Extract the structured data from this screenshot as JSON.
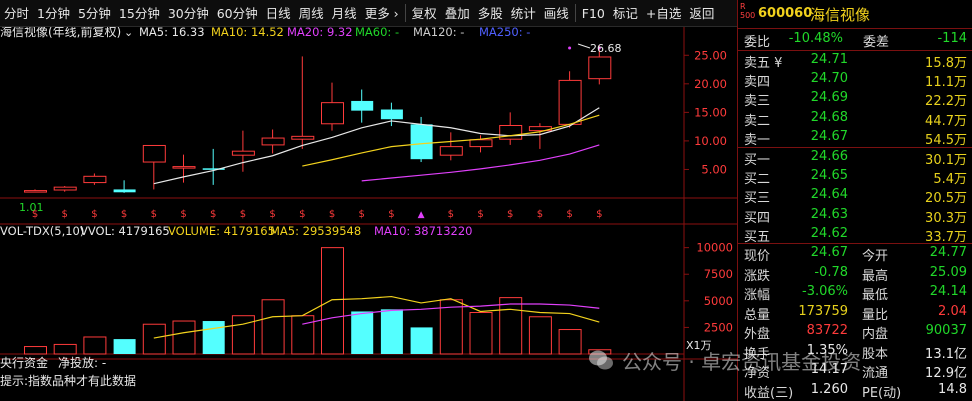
{
  "toolbar": {
    "items": [
      "分时",
      "1分钟",
      "5分钟",
      "15分钟",
      "30分钟",
      "60分钟",
      "日线",
      "周线",
      "月线",
      "更多 ›",
      "复权",
      "叠加",
      "多股",
      "统计",
      "画线",
      "F10",
      "标记",
      "+自选",
      "返回"
    ]
  },
  "kline": {
    "title": "海信视像(年线,前复权)",
    "ma_labels": [
      {
        "text": "MA5: 16.33",
        "color": "#e8e8e8"
      },
      {
        "text": "MA10: 14.52",
        "color": "#f2d21d"
      },
      {
        "text": "MA20: 9.32",
        "color": "#e040fb"
      },
      {
        "text": "MA60: -",
        "color": "#21d82a"
      },
      {
        "text": "MA120: -",
        "color": "#cccccc"
      },
      {
        "text": "MA250: -",
        "color": "#5060ff"
      }
    ],
    "high_label": "26.68",
    "low_label": "1.01",
    "y_ticks": [
      "25.00",
      "20.00",
      "15.00",
      "10.00",
      "5.00"
    ],
    "marker_glyph": "$",
    "marker_arrow": "▲"
  },
  "volume": {
    "title_parts": [
      {
        "text": "VOL-TDX(5,10)",
        "color": "#e8e8e8"
      },
      {
        "text": "VVOL: 4179165",
        "color": "#e8e8e8"
      },
      {
        "text": "VOLUME: 4179165",
        "color": "#f2d21d"
      },
      {
        "text": "MA5: 29539548",
        "color": "#f2d21d"
      },
      {
        "text": "MA10: 38713220",
        "color": "#e040fb"
      }
    ],
    "y_ticks": [
      "10000",
      "7500",
      "5000",
      "2500"
    ],
    "unit_label": "X1万"
  },
  "bottom": {
    "line1_a": "央行资金",
    "line1_b": "净投放: -",
    "line2": "提示:指数品种才有此数据"
  },
  "quote": {
    "code": "600060",
    "name": "海信视像",
    "badge_r": "R",
    "badge_num": "500",
    "weibi_label": "委比",
    "weibi": "-10.48%",
    "weicha_label": "委差",
    "weicha": "-114",
    "asks": [
      {
        "label": "卖五 ¥",
        "price": "24.71",
        "vol": "15.8万"
      },
      {
        "label": "卖四",
        "price": "24.70",
        "vol": "11.1万"
      },
      {
        "label": "卖三",
        "price": "24.69",
        "vol": "22.2万"
      },
      {
        "label": "卖二",
        "price": "24.68",
        "vol": "44.7万"
      },
      {
        "label": "卖一",
        "price": "24.67",
        "vol": "54.5万"
      }
    ],
    "bids": [
      {
        "label": "买一",
        "price": "24.66",
        "vol": "30.1万"
      },
      {
        "label": "买二",
        "price": "24.65",
        "vol": "5.4万"
      },
      {
        "label": "买三",
        "price": "24.64",
        "vol": "20.5万"
      },
      {
        "label": "买四",
        "price": "24.63",
        "vol": "30.3万"
      },
      {
        "label": "买五",
        "price": "24.62",
        "vol": "33.7万"
      }
    ],
    "stats": [
      {
        "l1": "现价",
        "v1": "24.67",
        "c1": "green",
        "l2": "今开",
        "v2": "24.77",
        "c2": "green"
      },
      {
        "l1": "涨跌",
        "v1": "-0.78",
        "c1": "green",
        "l2": "最高",
        "v2": "25.09",
        "c2": "green"
      },
      {
        "l1": "涨幅",
        "v1": "-3.06%",
        "c1": "green",
        "l2": "最低",
        "v2": "24.14",
        "c2": "green"
      },
      {
        "l1": "总量",
        "v1": "173759",
        "c1": "yellow",
        "l2": "量比",
        "v2": "2.04",
        "c2": "red"
      },
      {
        "l1": "外盘",
        "v1": "83722",
        "c1": "red",
        "l2": "内盘",
        "v2": "90037",
        "c2": "green"
      },
      {
        "l1": "换手",
        "v1": "1.35%",
        "c1": "white",
        "l2": "股本",
        "v2": "13.1亿",
        "c2": "white"
      },
      {
        "l1": "净资",
        "v1": "14.17",
        "c1": "white",
        "l2": "流通",
        "v2": "12.9亿",
        "c2": "white"
      },
      {
        "l1": "收益(三)",
        "v1": "1.260",
        "c1": "white",
        "l2": "PE(动)",
        "v2": "14.8",
        "c2": "white"
      }
    ]
  },
  "watermark": "公众号 · 卓宏资讯基金投资",
  "colors": {
    "up": "#ff3b3b",
    "down": "#54ffff",
    "ma5": "#e8e8e8",
    "ma10": "#f2d21d",
    "ma20": "#e040fb",
    "grid": "#8b1010"
  },
  "chart_data": {
    "type": "candlestick",
    "title": "海信视像(年线,前复权)",
    "candles": [
      {
        "open": 1.2,
        "close": 1.3,
        "high": 1.5,
        "low": 1.01
      },
      {
        "open": 1.4,
        "close": 1.9,
        "high": 2.1,
        "low": 1.1
      },
      {
        "open": 2.7,
        "close": 3.8,
        "high": 4.3,
        "low": 2.3
      },
      {
        "open": 1.5,
        "close": 1.0,
        "high": 3.1,
        "low": 0.9
      },
      {
        "open": 6.3,
        "close": 9.2,
        "high": 9.2,
        "low": 1.5
      },
      {
        "open": 5.4,
        "close": 5.5,
        "high": 7.6,
        "low": 2.7
      },
      {
        "open": 5.2,
        "close": 5.0,
        "high": 8.6,
        "low": 2.3
      },
      {
        "open": 7.5,
        "close": 8.2,
        "high": 11.8,
        "low": 4.6
      },
      {
        "open": 9.3,
        "close": 10.5,
        "high": 12.0,
        "low": 7.8
      },
      {
        "open": 10.3,
        "close": 10.8,
        "high": 24.8,
        "low": 8.6
      },
      {
        "open": 13.0,
        "close": 16.7,
        "high": 20.2,
        "low": 11.8
      },
      {
        "open": 17.0,
        "close": 15.3,
        "high": 19.0,
        "low": 13.2
      },
      {
        "open": 15.5,
        "close": 13.8,
        "high": 16.7,
        "low": 12.6
      },
      {
        "open": 12.9,
        "close": 6.8,
        "high": 14.2,
        "low": 6.3
      },
      {
        "open": 7.5,
        "close": 9.0,
        "high": 11.5,
        "low": 6.6
      },
      {
        "open": 9.0,
        "close": 10.2,
        "high": 11.0,
        "low": 8.0
      },
      {
        "open": 10.3,
        "close": 12.7,
        "high": 15.0,
        "low": 9.3
      },
      {
        "open": 11.8,
        "close": 12.5,
        "high": 13.1,
        "low": 8.6
      },
      {
        "open": 12.9,
        "close": 20.6,
        "high": 22.2,
        "low": 12.3
      },
      {
        "open": 20.9,
        "close": 24.7,
        "high": 26.68,
        "low": 19.9
      }
    ],
    "ma5": [
      null,
      null,
      null,
      null,
      2.5,
      3.7,
      4.8,
      6.2,
      7.4,
      9.2,
      10.6,
      12.3,
      13.5,
      12.9,
      12.3,
      11.3,
      10.9,
      11.1,
      12.6,
      15.8
    ],
    "ma10": [
      null,
      null,
      null,
      null,
      null,
      null,
      null,
      null,
      null,
      5.6,
      6.7,
      7.9,
      9.0,
      9.5,
      9.9,
      10.3,
      10.9,
      11.6,
      12.9,
      14.5
    ],
    "ma20": [
      null,
      null,
      null,
      null,
      null,
      null,
      null,
      null,
      null,
      null,
      null,
      3.0,
      3.5,
      4.0,
      4.5,
      5.1,
      5.8,
      6.6,
      7.7,
      9.3
    ],
    "volume": [
      700,
      900,
      1600,
      1400,
      2800,
      3100,
      3100,
      3600,
      5100,
      3600,
      10000,
      4000,
      4200,
      2500,
      5100,
      3900,
      5300,
      3500,
      2300,
      400
    ],
    "vol_ma5": [
      null,
      null,
      null,
      null,
      1500,
      2000,
      2400,
      2800,
      3500,
      3600,
      5100,
      5200,
      5400,
      4800,
      5200,
      4000,
      4200,
      3900,
      3800,
      3000
    ],
    "vol_ma10": [
      null,
      null,
      null,
      null,
      null,
      null,
      null,
      null,
      null,
      2800,
      3400,
      3800,
      4100,
      4200,
      4400,
      4500,
      4700,
      4700,
      4600,
      4300
    ],
    "ylim": [
      0,
      27.5
    ],
    "vol_ylim": [
      0,
      11000
    ]
  }
}
